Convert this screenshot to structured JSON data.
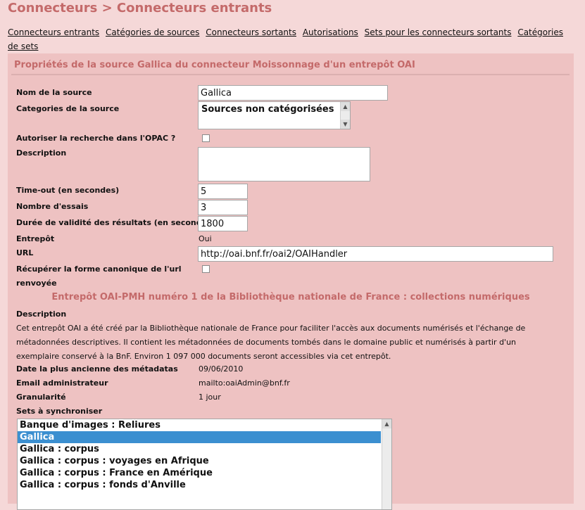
{
  "page_title": "Connecteurs > Connecteurs entrants",
  "nav": {
    "items": [
      "Connecteurs entrants",
      "Catégories de sources",
      "Connecteurs sortants",
      "Autorisations",
      "Sets pour les connecteurs sortants",
      "Catégories de sets"
    ]
  },
  "panel": {
    "title": "Propriétés de la source Gallica du connecteur Moissonnage d'un entrepôt OAI"
  },
  "form": {
    "source_name_label": "Nom de la source",
    "source_name_value": "Gallica",
    "categories_label": "Categories de la source",
    "categories_selected": "Sources non catégorisées",
    "opac_label": "Autoriser la recherche dans l'OPAC ?",
    "description_label": "Description",
    "description_value": "",
    "timeout_label": "Time-out (en secondes)",
    "timeout_value": "5",
    "retries_label": "Nombre d'essais",
    "retries_value": "3",
    "validity_label": "Durée de validité des résultats (en secondes)",
    "validity_value": "1800",
    "warehouse_label": "Entrepôt",
    "warehouse_value": "Oui",
    "url_label": "URL",
    "url_value": "http://oai.bnf.fr/oai2/OAIHandler",
    "canonical_label_line1": "Récupérer la forme canonique de l'url",
    "canonical_label_line2": "renvoyée"
  },
  "warehouse_info": {
    "heading": "Entrepôt OAI-PMH numéro 1 de la Bibliothèque nationale de France : collections numériques",
    "description_label": "Description",
    "description_text": "Cet entrepôt OAI a été créé par la Bibliothèque nationale de France pour faciliter l'accès aux documents numérisés et l'échange de métadonnées descriptives. Il contient les métadonnées de documents tombés dans le domaine public et numérisés à partir d'un exemplaire conservé à la BnF. Environ 1 097 000 documents seront accessibles via cet entrepôt.",
    "oldest_date_label": "Date la plus ancienne des métadatas",
    "oldest_date_value": "09/06/2010",
    "admin_email_label": "Email administrateur",
    "admin_email_value": "mailto:oaiAdmin@bnf.fr",
    "granularity_label": "Granularité",
    "granularity_value": "1 jour"
  },
  "sets": {
    "label": "Sets à synchroniser",
    "items": [
      "Banque d'images : Reliures",
      "Gallica",
      "Gallica : corpus",
      "Gallica : corpus : voyages en Afrique",
      "Gallica : corpus : France en Amérique",
      "Gallica : corpus : fonds d'Anville"
    ],
    "selected_index": 1
  },
  "colors": {
    "background": "#f5d8d8",
    "panel": "#eec2c2",
    "accent": "#c46a6a",
    "selection": "#3b8fd0"
  },
  "icons": {
    "scroll_up": "triangle-up-icon",
    "scroll_down": "triangle-down-icon"
  }
}
